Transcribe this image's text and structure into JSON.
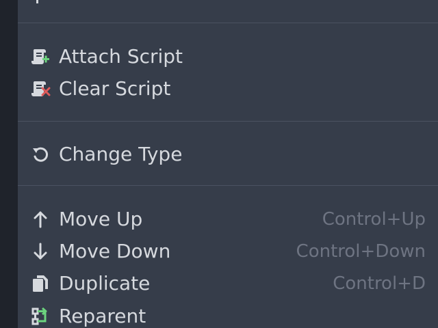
{
  "menu": {
    "groups": [
      {
        "items": [
          {
            "label": "Attach Script",
            "icon": "script-add-icon",
            "shortcut": ""
          },
          {
            "label": "Clear Script",
            "icon": "script-remove-icon",
            "shortcut": ""
          }
        ]
      },
      {
        "items": [
          {
            "label": "Change Type",
            "icon": "rotate-icon",
            "shortcut": ""
          }
        ]
      },
      {
        "items": [
          {
            "label": "Move Up",
            "icon": "arrow-up-icon",
            "shortcut": "Control+Up"
          },
          {
            "label": "Move Down",
            "icon": "arrow-down-icon",
            "shortcut": "Control+Down"
          },
          {
            "label": "Duplicate",
            "icon": "duplicate-icon",
            "shortcut": "Control+D"
          },
          {
            "label": "Reparent",
            "icon": "reparent-icon",
            "shortcut": ""
          }
        ]
      }
    ]
  },
  "colors": {
    "menu_bg": "#363d4a",
    "label": "#d6d9de",
    "shortcut": "#6e7482",
    "separator": "#4b5261",
    "script_add": "#6cd47e",
    "script_remove": "#e05b5b"
  }
}
